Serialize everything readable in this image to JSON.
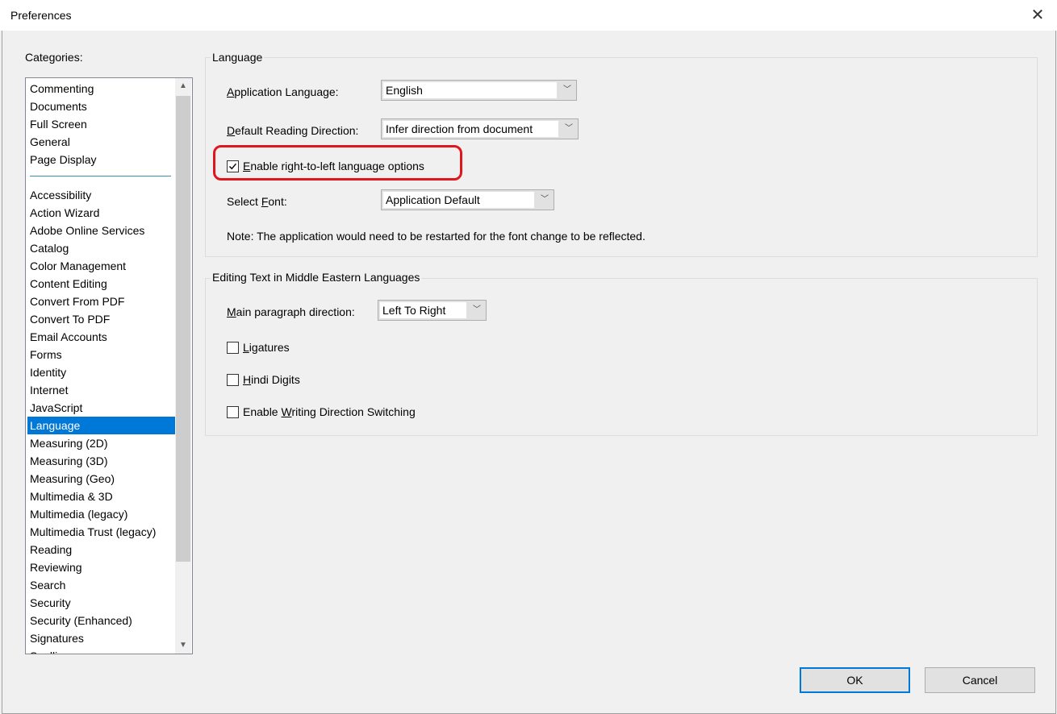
{
  "window": {
    "title": "Preferences",
    "close_glyph": "✕"
  },
  "categories": {
    "label": "Categories:",
    "top_items": [
      "Commenting",
      "Documents",
      "Full Screen",
      "General",
      "Page Display"
    ],
    "items": [
      "Accessibility",
      "Action Wizard",
      "Adobe Online Services",
      "Catalog",
      "Color Management",
      "Content Editing",
      "Convert From PDF",
      "Convert To PDF",
      "Email Accounts",
      "Forms",
      "Identity",
      "Internet",
      "JavaScript",
      "Language",
      "Measuring (2D)",
      "Measuring (3D)",
      "Measuring (Geo)",
      "Multimedia & 3D",
      "Multimedia (legacy)",
      "Multimedia Trust (legacy)",
      "Reading",
      "Reviewing",
      "Search",
      "Security",
      "Security (Enhanced)",
      "Signatures",
      "Spelling"
    ],
    "selected": "Language"
  },
  "language_group": {
    "title": "Language",
    "app_language_label": "Application Language:",
    "app_language_value": "English",
    "reading_direction_label": "Default Reading Direction:",
    "reading_direction_value": "Infer direction from document",
    "rtl_option_label": "Enable right-to-left language options",
    "rtl_option_checked": true,
    "select_font_label": "Select Font:",
    "select_font_value": "Application Default",
    "note": "Note: The application would need to be restarted for the font change to be reflected."
  },
  "middle_eastern_group": {
    "title": "Editing Text in Middle Eastern Languages",
    "paragraph_direction_label": "Main paragraph direction:",
    "paragraph_direction_value": "Left To Right",
    "ligatures_label": "Ligatures",
    "ligatures_checked": false,
    "hindi_digits_label": "Hindi Digits",
    "hindi_digits_checked": false,
    "writing_direction_label": "Enable Writing Direction Switching",
    "writing_direction_checked": false
  },
  "buttons": {
    "ok": "OK",
    "cancel": "Cancel"
  },
  "colors": {
    "selection": "#0078d7",
    "highlight_outline": "#e0161d"
  }
}
